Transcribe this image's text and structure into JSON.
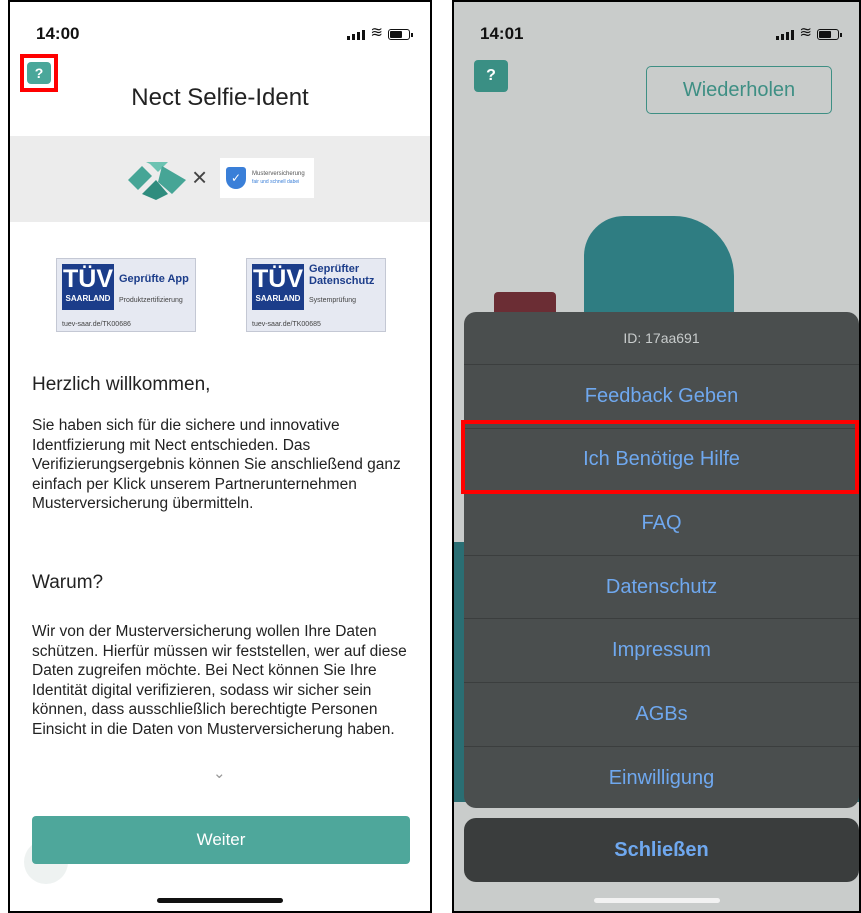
{
  "left": {
    "status": {
      "time": "14:00"
    },
    "help_icon": "?",
    "title": "Nect Selfie-Ident",
    "partner": {
      "separator": "×",
      "muster_name": "Musterversicherung",
      "muster_tagline": "fair und schnell dabei"
    },
    "tuv_badges": [
      {
        "brand": "TÜV",
        "region": "SAARLAND",
        "label": "Geprüfte App",
        "sub": "Produktzertifizierung",
        "url": "tuev-saar.de/TK00686"
      },
      {
        "brand": "TÜV",
        "region": "SAARLAND",
        "label": "Geprüfter Datenschutz",
        "sub": "Systemprüfung",
        "url": "tuev-saar.de/TK00685"
      }
    ],
    "welcome_heading": "Herzlich willkommen,",
    "welcome_text": "Sie haben sich für die sichere und innovative Identfizierung mit Nect entschieden. Das Verifizierungsergebnis können Sie anschließend ganz einfach per Klick unserem Partnerunternehmen Musterversicherung übermitteln.",
    "why_heading": "Warum?",
    "why_text": "Wir von der Musterversicherung wollen Ihre Daten schützen. Hierfür müssen wir feststellen, wer auf diese Daten zugreifen möchte. Bei Nect können Sie Ihre Identität digital verifizieren, sodass wir sicher sein können, dass ausschließlich berechtigte Personen Einsicht in die Daten von Musterversicherung haben.",
    "chevron": "⌄",
    "continue_label": "Weiter"
  },
  "right": {
    "status": {
      "time": "14:01"
    },
    "help_icon": "?",
    "repeat_label": "Wiederholen",
    "sheet": {
      "id_label": "ID: 17aa691",
      "items": [
        "Feedback Geben",
        "Ich Benötige Hilfe",
        "FAQ",
        "Datenschutz",
        "Impressum",
        "AGBs",
        "Einwilligung"
      ],
      "close_label": "Schließen"
    }
  },
  "colors": {
    "teal": "#4ea79b",
    "ios_blue": "#6fa8ef",
    "highlight_red": "#ff0000"
  }
}
